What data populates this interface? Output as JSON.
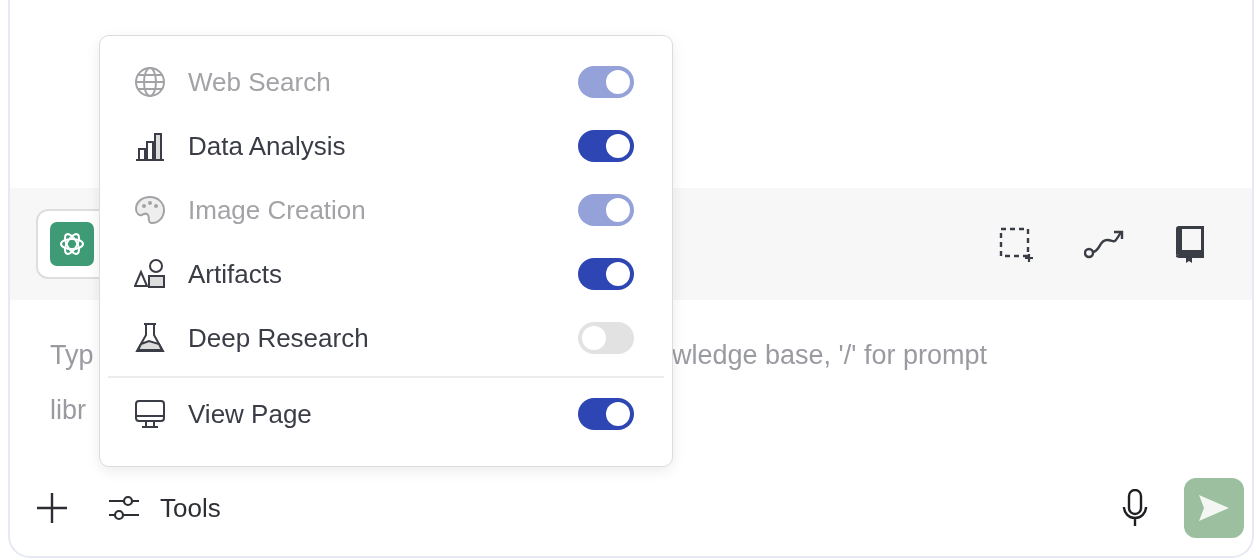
{
  "composer": {
    "placeholder_parts": [
      "Typ",
      "wledge base, '/' for prompt",
      "libr"
    ],
    "tools_label": "Tools"
  },
  "menu": {
    "sections": [
      {
        "items": [
          {
            "kind": "globe",
            "label": "Web Search",
            "on": true,
            "disabled": true
          },
          {
            "kind": "bars",
            "label": "Data Analysis",
            "on": true,
            "disabled": false
          },
          {
            "kind": "palette",
            "label": "Image Creation",
            "on": true,
            "disabled": true
          },
          {
            "kind": "shapes",
            "label": "Artifacts",
            "on": true,
            "disabled": false
          },
          {
            "kind": "flask",
            "label": "Deep Research",
            "on": false,
            "disabled": false
          }
        ]
      },
      {
        "items": [
          {
            "kind": "monitor",
            "label": "View Page",
            "on": true,
            "disabled": false
          }
        ]
      }
    ]
  }
}
